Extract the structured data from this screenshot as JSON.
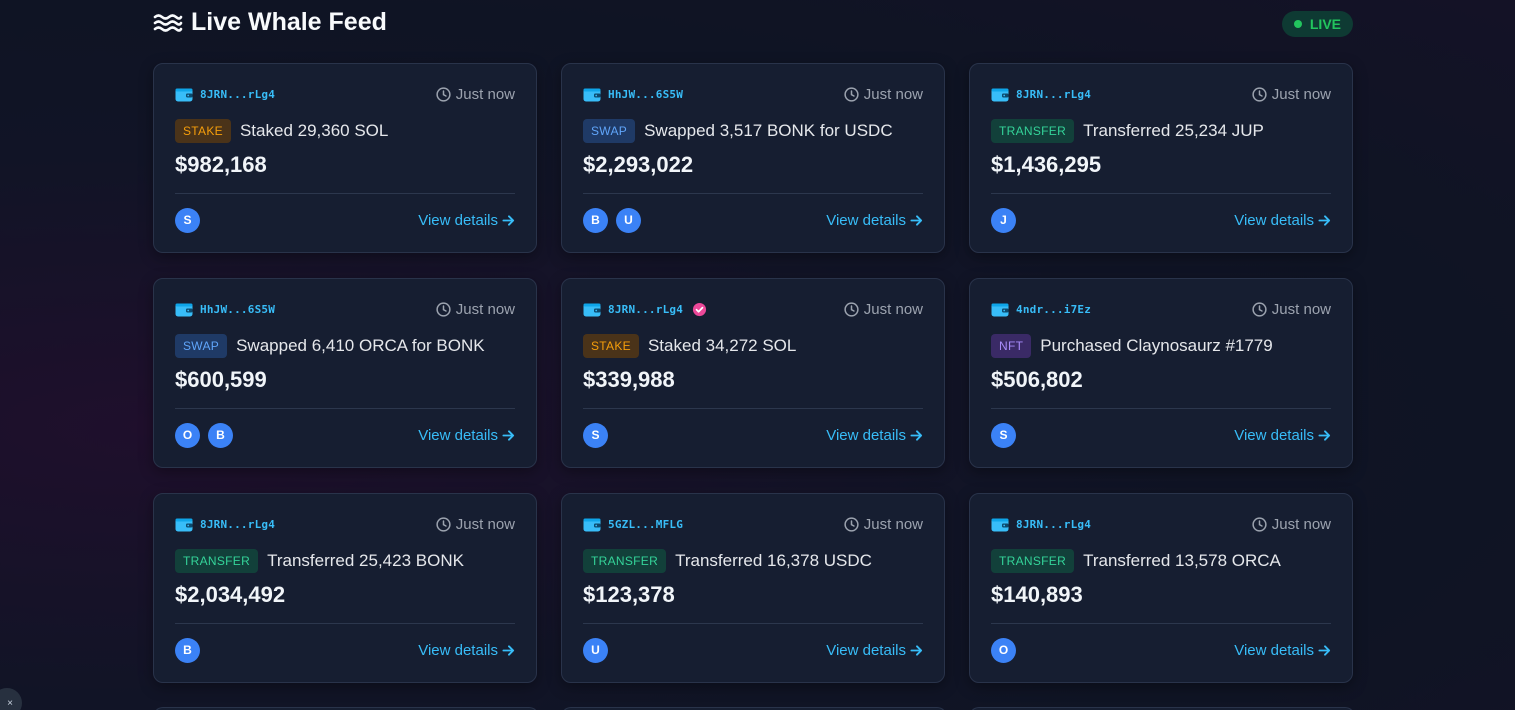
{
  "header": {
    "title": "Live Whale Feed",
    "live_label": "LIVE"
  },
  "colors": {
    "accent": "#38bdf8",
    "live_green": "#22c55e",
    "stake": "#f59e0b",
    "swap": "#60a5fa",
    "transfer": "#34d399",
    "nft": "#a78bfa",
    "token_avatar": "#3b82f6",
    "verified": "#ec4899"
  },
  "cards": [
    {
      "address": "8JRN...rLg4",
      "verified": false,
      "time": "Just now",
      "type": "STAKE",
      "description": "Staked 29,360 SOL",
      "amount": "$982,168",
      "tokens": [
        "S"
      ],
      "link": "View details"
    },
    {
      "address": "HhJW...6S5W",
      "verified": false,
      "time": "Just now",
      "type": "SWAP",
      "description": "Swapped 3,517 BONK for USDC",
      "amount": "$2,293,022",
      "tokens": [
        "B",
        "U"
      ],
      "link": "View details"
    },
    {
      "address": "8JRN...rLg4",
      "verified": false,
      "time": "Just now",
      "type": "TRANSFER",
      "description": "Transferred 25,234 JUP",
      "amount": "$1,436,295",
      "tokens": [
        "J"
      ],
      "link": "View details"
    },
    {
      "address": "HhJW...6S5W",
      "verified": false,
      "time": "Just now",
      "type": "SWAP",
      "description": "Swapped 6,410 ORCA for BONK",
      "amount": "$600,599",
      "tokens": [
        "O",
        "B"
      ],
      "link": "View details"
    },
    {
      "address": "8JRN...rLg4",
      "verified": true,
      "time": "Just now",
      "type": "STAKE",
      "description": "Staked 34,272 SOL",
      "amount": "$339,988",
      "tokens": [
        "S"
      ],
      "link": "View details"
    },
    {
      "address": "4ndr...i7Ez",
      "verified": false,
      "time": "Just now",
      "type": "NFT",
      "description": "Purchased Claynosaurz #1779",
      "amount": "$506,802",
      "tokens": [
        "S"
      ],
      "link": "View details"
    },
    {
      "address": "8JRN...rLg4",
      "verified": false,
      "time": "Just now",
      "type": "TRANSFER",
      "description": "Transferred 25,423 BONK",
      "amount": "$2,034,492",
      "tokens": [
        "B"
      ],
      "link": "View details"
    },
    {
      "address": "5GZL...MFLG",
      "verified": false,
      "time": "Just now",
      "type": "TRANSFER",
      "description": "Transferred 16,378 USDC",
      "amount": "$123,378",
      "tokens": [
        "U"
      ],
      "link": "View details"
    },
    {
      "address": "8JRN...rLg4",
      "verified": false,
      "time": "Just now",
      "type": "TRANSFER",
      "description": "Transferred 13,578 ORCA",
      "amount": "$140,893",
      "tokens": [
        "O"
      ],
      "link": "View details"
    }
  ]
}
